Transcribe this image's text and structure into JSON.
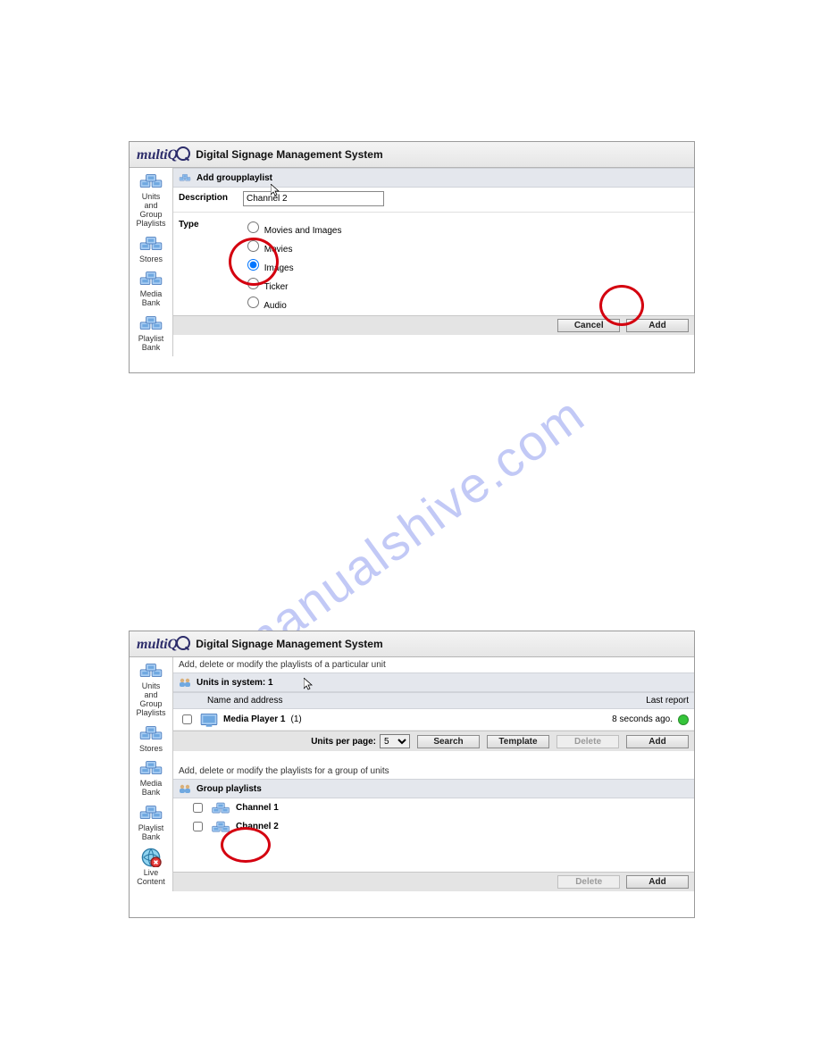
{
  "brand": "multiQ",
  "app_title": "Digital Signage Management System",
  "sidebar1": [
    {
      "label": "Units\nand\nGroup\nPlaylists"
    },
    {
      "label": "Stores"
    },
    {
      "label": "Media\nBank"
    },
    {
      "label": "Playlist\nBank"
    }
  ],
  "add_playlist": {
    "section": "Add groupplaylist",
    "description_label": "Description",
    "description_value": "Channel 2",
    "type_label": "Type",
    "options": {
      "movies_images": "Movies and Images",
      "movies": "Movies",
      "images": "Images",
      "ticker": "Ticker",
      "audio": "Audio"
    },
    "selected": "images",
    "cancel": "Cancel",
    "add": "Add"
  },
  "panel2": {
    "hint_units": "Add, delete or modify the playlists of a particular unit",
    "units_header": "Units in system: 1",
    "col_name": "Name and address",
    "col_last": "Last report",
    "unit_row": {
      "name": "Media Player 1",
      "count": "(1)",
      "last": "8 seconds ago."
    },
    "paging": {
      "label": "Units per page:",
      "value": "5",
      "search": "Search",
      "template": "Template",
      "delete": "Delete",
      "add": "Add"
    },
    "hint_groups": "Add, delete or modify the playlists for a group of units",
    "groups_header": "Group playlists",
    "groups": [
      "Channel 1",
      "Channel 2"
    ],
    "footer": {
      "delete": "Delete",
      "add": "Add"
    }
  },
  "sidebar2": [
    {
      "label": "Units\nand\nGroup\nPlaylists"
    },
    {
      "label": "Stores"
    },
    {
      "label": "Media\nBank"
    },
    {
      "label": "Playlist\nBank"
    },
    {
      "label": "Live\nContent"
    }
  ],
  "watermark": "manualshive.com"
}
